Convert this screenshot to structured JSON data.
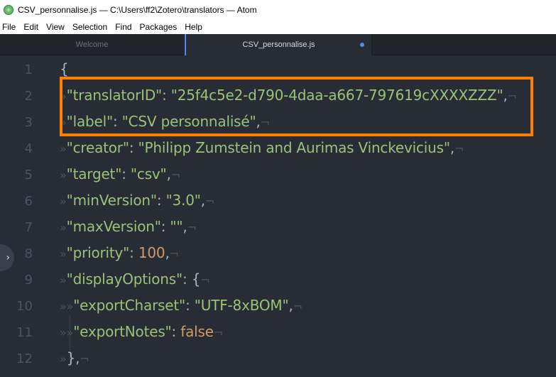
{
  "window": {
    "title": "CSV_personnalise.js — C:\\Users\\ff2\\Zotero\\translators — Atom"
  },
  "menu": [
    "File",
    "Edit",
    "View",
    "Selection",
    "Find",
    "Packages",
    "Help"
  ],
  "tabs": {
    "welcome": "Welcome",
    "active": "CSV_personnalise.js"
  },
  "line_numbers": [
    "1",
    "2",
    "3",
    "4",
    "5",
    "6",
    "7",
    "8",
    "9",
    "10",
    "11",
    "12"
  ],
  "code": {
    "l1": {
      "open": "{"
    },
    "l2": {
      "key": "\"translatorID\"",
      "colon": ": ",
      "value": "\"25f4c5e2-d790-4daa-a667-797619cXXXXZZZ\"",
      "end": ","
    },
    "l3": {
      "key": "\"label\"",
      "colon": ": ",
      "value": "\"CSV personnalisé\"",
      "end": ","
    },
    "l4": {
      "key": "\"creator\"",
      "colon": ": ",
      "value": "\"Philipp Zumstein and Aurimas Vinckevicius\"",
      "end": ","
    },
    "l5": {
      "key": "\"target\"",
      "colon": ": ",
      "value": "\"csv\"",
      "end": ","
    },
    "l6": {
      "key": "\"minVersion\"",
      "colon": ": ",
      "value": "\"3.0\"",
      "end": ","
    },
    "l7": {
      "key": "\"maxVersion\"",
      "colon": ": ",
      "value": "\"\"",
      "end": ","
    },
    "l8": {
      "key": "\"priority\"",
      "colon": ": ",
      "value": "100",
      "end": ","
    },
    "l9": {
      "key": "\"displayOptions\"",
      "colon": ": ",
      "value": "{",
      "end": ""
    },
    "l10": {
      "key": "\"exportCharset\"",
      "colon": ": ",
      "value": "\"UTF-8xBOM\"",
      "end": ","
    },
    "l11": {
      "key": "\"exportNotes\"",
      "colon": ": ",
      "value": "false",
      "end": ""
    },
    "l12": {
      "close": "}",
      "end": ","
    }
  },
  "invisibles": {
    "eol": "¬",
    "tab": "»"
  },
  "colors": {
    "highlight_box": "#ff8000",
    "string": "#98c379",
    "number": "#d19a66",
    "tab_accent": "#568af2"
  }
}
